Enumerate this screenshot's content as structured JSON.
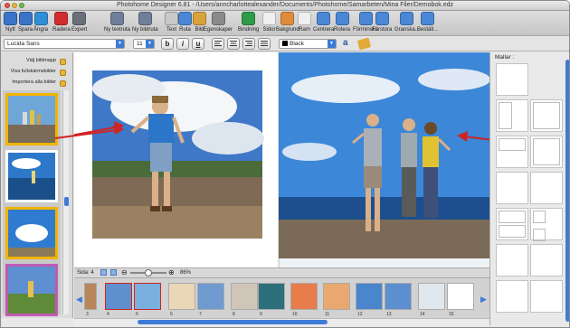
{
  "window": {
    "title": "Photohome Designer 6.81 - /Users/anncharlottealexander/Documents/Photohome/Samarbeten/Mina Filer/Demobok.edz"
  },
  "toolbar": {
    "buttons": [
      {
        "label": "Nytt",
        "color": "#3a74c9"
      },
      {
        "label": "Spara",
        "color": "#3a74c9"
      },
      {
        "label": "Ångra",
        "color": "#2f8fd6"
      },
      {
        "label": "Radera",
        "color": "#d22d2d"
      },
      {
        "label": "Expert",
        "color": "#6a6f7a"
      },
      {
        "label": "Ny textruta",
        "color": "#6f7f99"
      },
      {
        "label": "Ny bildruta",
        "color": "#6f7f99"
      },
      {
        "label": "Text",
        "color": "#c9c9c9"
      },
      {
        "label": "Ruta",
        "color": "#4a87d6"
      },
      {
        "label": "Bild",
        "color": "#d9a23a"
      },
      {
        "label": "Egenskaper",
        "color": "#8a8a8a"
      },
      {
        "label": "Bindning",
        "color": "#2f9a47"
      },
      {
        "label": "Sidor",
        "color": "#f0f0f0"
      },
      {
        "label": "Bakgrund",
        "color": "#e08b3b"
      },
      {
        "label": "Ram",
        "color": "#f0f0f0"
      },
      {
        "label": "Centrera",
        "color": "#4a87d6"
      },
      {
        "label": "Rotera",
        "color": "#4a87d6"
      },
      {
        "label": "Förminska",
        "color": "#4a87d6"
      },
      {
        "label": "Förstora",
        "color": "#4a87d6"
      },
      {
        "label": "Granska...",
        "color": "#4a87d6"
      },
      {
        "label": "Beställ...",
        "color": "#4a87d6"
      }
    ]
  },
  "fontbar": {
    "font": "Lucida Sans",
    "size": "11",
    "bold": "b",
    "italic": "i",
    "underline": "u",
    "color_label": "Black"
  },
  "left": {
    "buttons": [
      "Välj bildmapp",
      "Visa fullskärmsbilder",
      "Importera alla bilder"
    ]
  },
  "statusbar": {
    "page_label": "Sida: 4",
    "zoom": "86%"
  },
  "filmstrip": {
    "numbers": [
      "3",
      "4",
      "5",
      "6",
      "7",
      "8",
      "9",
      "10",
      "11",
      "12",
      "13",
      "14",
      "15"
    ]
  },
  "right": {
    "title": "Mallar :"
  },
  "colors": {
    "accent": "#3d7bd6",
    "arrow": "#d02323"
  }
}
